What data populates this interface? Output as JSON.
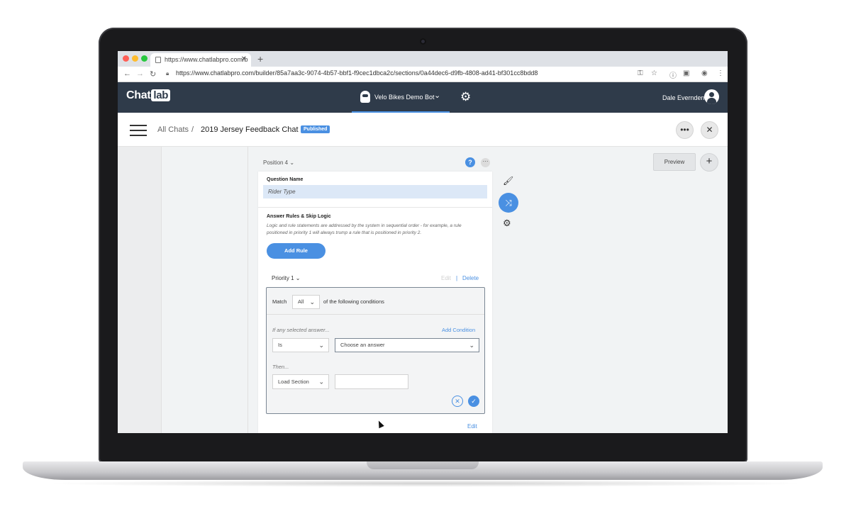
{
  "browser": {
    "tab_title": "https://www.chatlabpro.com/b",
    "url": "https://www.chatlabpro.com/builder/85a7aa3c-9074-4b57-bbf1-f9cec1dbca2c/sections/0a44dec6-d9fb-4808-ad41-bf301cc8bdd8"
  },
  "app": {
    "logo": "Chat",
    "logo_box": "lab",
    "bot_name": "Velo Bikes Demo Bot",
    "user_name": "Dale Evernden"
  },
  "subheader": {
    "breadcrumb_root": "All Chats",
    "breadcrumb_sep": "/",
    "title": "2019 Jersey Feedback Chat",
    "status": "Published"
  },
  "editor": {
    "position_label": "Position 4",
    "question_name_label": "Question Name",
    "question_name_value": "Rider Type",
    "rules_title": "Answer Rules & Skip Logic",
    "rules_help": "Logic and rule statements are addressed by the system in sequential order - for example, a rule positioned in priority 1 will always trump a rule that is positioned in priority 2.",
    "add_rule_label": "Add Rule",
    "priority_label": "Priority 1",
    "edit_label": "Edit",
    "delete_label": "Delete",
    "match_label": "Match",
    "match_value": "All",
    "conditions_label": "of the following conditions",
    "if_label": "If any selected answer...",
    "add_condition_label": "Add Condition",
    "operator_value": "Is",
    "answer_placeholder": "Choose an answer",
    "then_label": "Then...",
    "action_value": "Load Section",
    "bottom_edit_label": "Edit"
  },
  "right": {
    "preview_label": "Preview"
  },
  "colors": {
    "accent": "#4a90e2",
    "header": "#2f3b4a"
  }
}
